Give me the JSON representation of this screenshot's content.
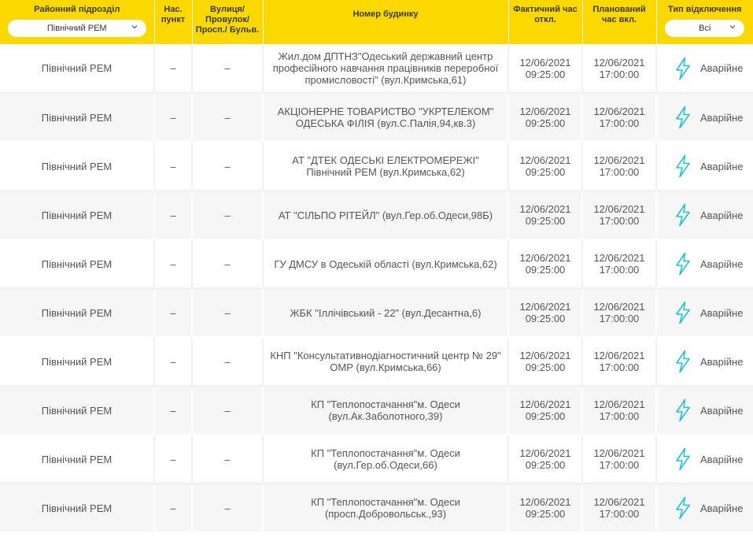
{
  "header": {
    "district_label": "Районний підрозділ",
    "district_filter_value": "Північний РЕМ",
    "settlement_label": "Нас. пункт",
    "street_label": "Вулиця/ Провулок/ Просп./ Бульв.",
    "house_label": "Номер будинку",
    "actual_time_label": "Фактичний час откл.",
    "planned_time_label": "Планований час вкл.",
    "type_label": "Тип відключення",
    "type_filter_value": "Всі"
  },
  "colors": {
    "header_bg": "#fbd800",
    "bolt_icon": "#20c4d6",
    "row_alt_bg": "#f6f6f6"
  },
  "icons": {
    "filter_chevron": "chevron-down-icon",
    "outage_type": "lightning-bolt-icon"
  },
  "rows": [
    {
      "district": "Північний РЕМ",
      "settlement": "–",
      "street": "–",
      "house": "Жил.дом ДПТНЗ\"Одеський державний центр професійного навчання працівників переробної промисловості\" (вул.Кримська,61)",
      "actual_date": "12/06/2021",
      "actual_time": "09:25:00",
      "planned_date": "12/06/2021",
      "planned_time": "17:00:00",
      "type": "Аварійне"
    },
    {
      "district": "Північний РЕМ",
      "settlement": "–",
      "street": "–",
      "house": "АКЦІОНЕРНЕ ТОВАРИСТВО \"УКРТЕЛЕКОМ\" ОДЕСЬКА ФІЛІЯ (вул.С.Палія,94,кв.3)",
      "actual_date": "12/06/2021",
      "actual_time": "09:25:00",
      "planned_date": "12/06/2021",
      "planned_time": "17:00:00",
      "type": "Аварійне"
    },
    {
      "district": "Північний РЕМ",
      "settlement": "–",
      "street": "–",
      "house": "АТ \"ДТЕК ОДЕСЬКІ ЕЛЕКТРОМЕРЕЖІ\" Північний РЕМ (вул.Кримська,62)",
      "actual_date": "12/06/2021",
      "actual_time": "09:25:00",
      "planned_date": "12/06/2021",
      "planned_time": "17:00:00",
      "type": "Аварійне"
    },
    {
      "district": "Північний РЕМ",
      "settlement": "–",
      "street": "–",
      "house": "АТ \"СІЛЬПО РІТЕЙЛ\" (вул.Гер.об.Одеси,98Б)",
      "actual_date": "12/06/2021",
      "actual_time": "09:25:00",
      "planned_date": "12/06/2021",
      "planned_time": "17:00:00",
      "type": "Аварійне"
    },
    {
      "district": "Північний РЕМ",
      "settlement": "–",
      "street": "–",
      "house": "ГУ ДМСУ в Одеській області (вул.Кримська,62)",
      "actual_date": "12/06/2021",
      "actual_time": "09:25:00",
      "planned_date": "12/06/2021",
      "planned_time": "17:00:00",
      "type": "Аварійне"
    },
    {
      "district": "Північний РЕМ",
      "settlement": "–",
      "street": "–",
      "house": "ЖБК \"Іллічівський - 22\" (вул.Десантна,6)",
      "actual_date": "12/06/2021",
      "actual_time": "09:25:00",
      "planned_date": "12/06/2021",
      "planned_time": "17:00:00",
      "type": "Аварійне"
    },
    {
      "district": "Північний РЕМ",
      "settlement": "–",
      "street": "–",
      "house": "КНП \"Консультативнодіагностичний центр № 29\" ОМР (вул.Кримська,66)",
      "actual_date": "12/06/2021",
      "actual_time": "09:25:00",
      "planned_date": "12/06/2021",
      "planned_time": "17:00:00",
      "type": "Аварійне"
    },
    {
      "district": "Північний РЕМ",
      "settlement": "–",
      "street": "–",
      "house": "КП \"Теплопостачання\"м. Одеси (вул.Ак.Заболотного,39)",
      "actual_date": "12/06/2021",
      "actual_time": "09:25:00",
      "planned_date": "12/06/2021",
      "planned_time": "17:00:00",
      "type": "Аварійне"
    },
    {
      "district": "Північний РЕМ",
      "settlement": "–",
      "street": "–",
      "house": "КП \"Теплопостачання\"м. Одеси (вул.Гер.об.Одеси,66)",
      "actual_date": "12/06/2021",
      "actual_time": "09:25:00",
      "planned_date": "12/06/2021",
      "planned_time": "17:00:00",
      "type": "Аварійне"
    },
    {
      "district": "Північний РЕМ",
      "settlement": "–",
      "street": "–",
      "house": "КП \"Теплопостачання\"м. Одеси (просп.Добровольськ.,93)",
      "actual_date": "12/06/2021",
      "actual_time": "09:25:00",
      "planned_date": "12/06/2021",
      "planned_time": "17:00:00",
      "type": "Аварійне"
    }
  ]
}
